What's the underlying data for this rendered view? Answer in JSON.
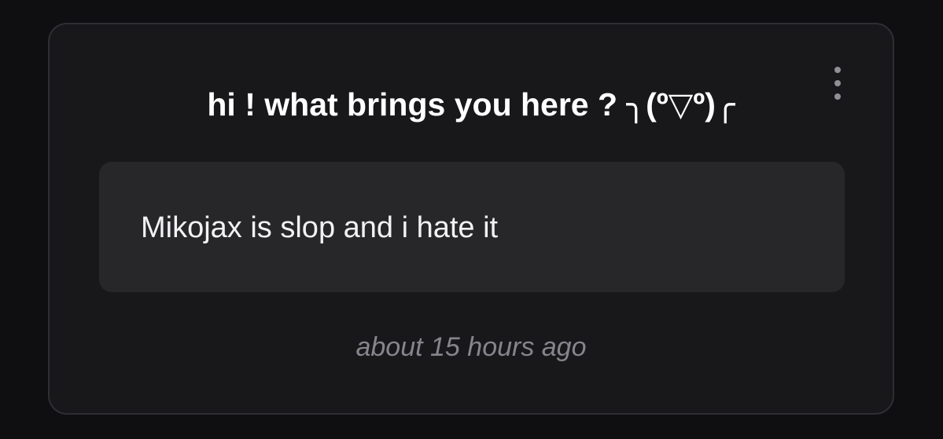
{
  "card": {
    "title": "hi ! what brings you here ? ╮(º▽º)╭",
    "menu_icon": "more-vertical-icon",
    "answer": "Mikojax is slop and i hate it",
    "timestamp": "about 15 hours ago"
  },
  "colors": {
    "page_background": "#0f0f11",
    "card_background": "#18181b",
    "card_border": "#2e2e33",
    "answer_background": "#27272a",
    "title_text": "#ffffff",
    "answer_text": "#f2f2f4",
    "timestamp_text": "#85858c",
    "menu_dots": "#8f8f96"
  }
}
